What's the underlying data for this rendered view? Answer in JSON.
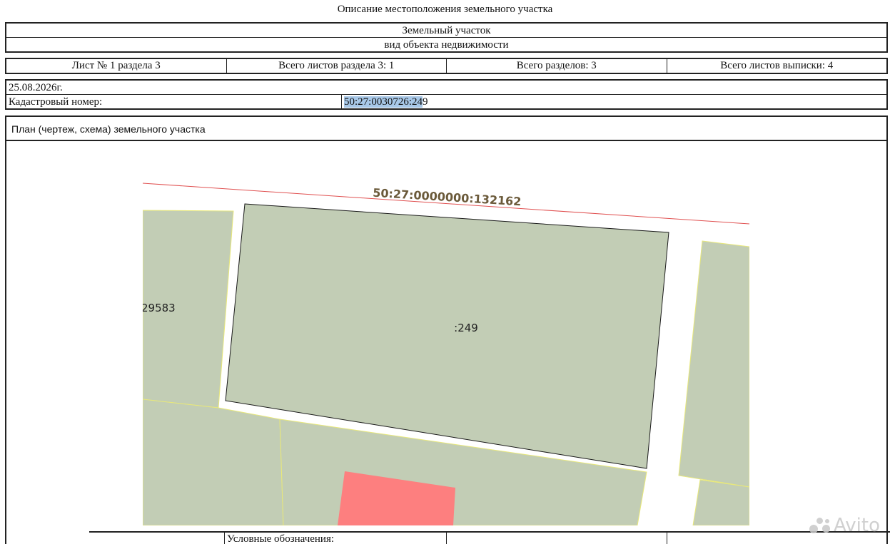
{
  "header": {
    "title": "Описание местоположения земельного участка",
    "object_name": "Земельный участок",
    "object_type": "вид объекта недвижимости"
  },
  "sheet_info": {
    "sheet": "Лист № 1 раздела 3",
    "sheets_in_section": "Всего листов раздела 3: 1",
    "sections_total": "Всего разделов: 3",
    "sheets_total": "Всего листов выписки: 4"
  },
  "details": {
    "date": "25.08.2026г.",
    "cadastral_label": "Кадастровый номер:",
    "cadastral_value_highlighted": "50:27:0030726:24",
    "cadastral_value_rest": "9"
  },
  "plan": {
    "title": "План (чертеж, схема) земельного участка",
    "road_parcel_label": "50:27:0000000:132162",
    "main_parcel_label": ":249",
    "left_parcel_label": "29583",
    "colors": {
      "parcel_fill": "#c2cdb5",
      "highlight_fill": "#fd7f7f",
      "boundary_red": "#e05050",
      "boundary_yellow": "#e8e87a",
      "road_label": "#6b5a3a"
    }
  },
  "legend": {
    "label": "Условные обозначения:"
  },
  "watermark": {
    "text": "Avito"
  }
}
